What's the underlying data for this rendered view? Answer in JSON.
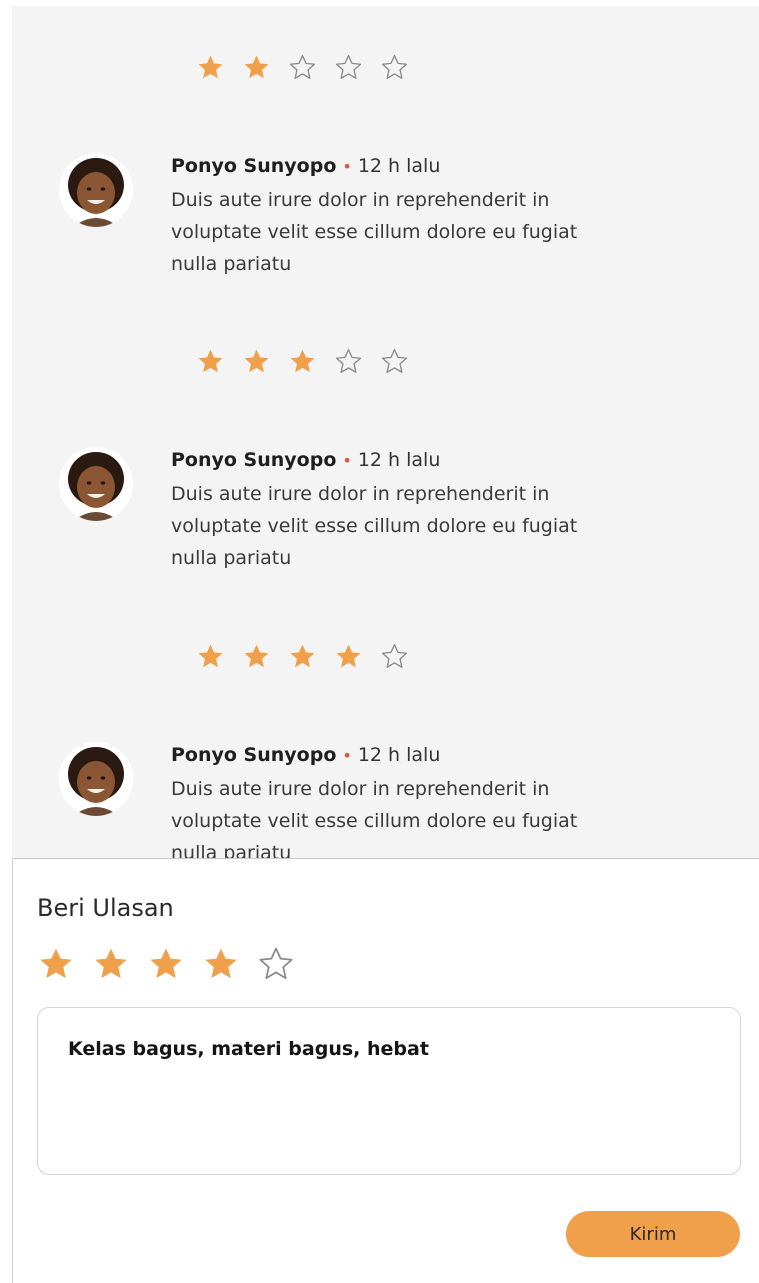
{
  "colors": {
    "accent": "#f0a04b",
    "dot": "#e2533f",
    "feed_bg": "#f4f4f4"
  },
  "reviews": [
    {
      "rating": 2,
      "name": "",
      "dot": "",
      "time": "",
      "text": ""
    },
    {
      "rating": 3,
      "name": "Ponyo Sunyopo",
      "dot": "•",
      "time": "12 h lalu",
      "text": "Duis aute irure dolor in reprehenderit in voluptate velit esse cillum dolore eu fugiat nulla pariatu"
    },
    {
      "rating": 4,
      "name": "Ponyo Sunyopo",
      "dot": "•",
      "time": "12 h lalu",
      "text": "Duis aute irure dolor in reprehenderit in voluptate velit esse cillum dolore eu fugiat nulla pariatu"
    },
    {
      "rating": 0,
      "name": "Ponyo Sunyopo",
      "dot": "•",
      "time": "12 h lalu",
      "text": "Duis aute irure dolor in reprehenderit in voluptate velit esse cillum dolore eu fugiat nulla pariatu"
    }
  ],
  "composer": {
    "title": "Beri Ulasan",
    "rating": 4,
    "text": "Kelas bagus, materi  bagus, hebat",
    "send_label": "Kirim"
  }
}
